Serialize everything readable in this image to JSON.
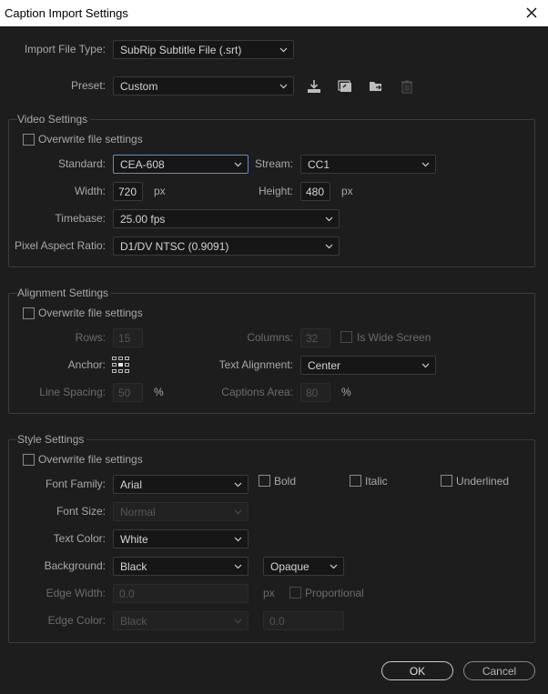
{
  "window": {
    "title": "Caption Import Settings"
  },
  "top": {
    "import_file_type_label": "Import File Type:",
    "import_file_type_value": "SubRip Subtitle File (.srt)",
    "preset_label": "Preset:",
    "preset_value": "Custom"
  },
  "video": {
    "legend": "Video Settings",
    "overwrite_label": "Overwrite file settings",
    "standard_label": "Standard:",
    "standard_value": "CEA-608",
    "stream_label": "Stream:",
    "stream_value": "CC1",
    "width_label": "Width:",
    "width_value": "720",
    "width_unit": "px",
    "height_label": "Height:",
    "height_value": "480",
    "height_unit": "px",
    "timebase_label": "Timebase:",
    "timebase_value": "25.00 fps",
    "par_label": "Pixel Aspect Ratio:",
    "par_value": "D1/DV NTSC (0.9091)"
  },
  "alignment": {
    "legend": "Alignment Settings",
    "overwrite_label": "Overwrite file settings",
    "rows_label": "Rows:",
    "rows_value": "15",
    "columns_label": "Columns:",
    "columns_value": "32",
    "wide_screen_label": "Is Wide Screen",
    "anchor_label": "Anchor:",
    "text_alignment_label": "Text Alignment:",
    "text_alignment_value": "Center",
    "line_spacing_label": "Line Spacing:",
    "line_spacing_value": "50",
    "line_spacing_unit": "%",
    "captions_area_label": "Captions Area:",
    "captions_area_value": "80",
    "captions_area_unit": "%"
  },
  "style": {
    "legend": "Style Settings",
    "overwrite_label": "Overwrite file settings",
    "font_family_label": "Font Family:",
    "font_family_value": "Arial",
    "bold_label": "Bold",
    "italic_label": "Italic",
    "underlined_label": "Underlined",
    "font_size_label": "Font Size:",
    "font_size_value": "Normal",
    "text_color_label": "Text Color:",
    "text_color_value": "White",
    "background_label": "Background:",
    "background_value": "Black",
    "opacity_value": "Opaque",
    "edge_width_label": "Edge Width:",
    "edge_width_value": "0.0",
    "edge_width_unit": "px",
    "proportional_label": "Proportional",
    "edge_color_label": "Edge Color:",
    "edge_color_value": "Black",
    "edge_opacity_value": "0.0"
  },
  "buttons": {
    "ok": "OK",
    "cancel": "Cancel"
  },
  "colors": {
    "background": "#1d1d1d",
    "focus_border": "#5a8fd6",
    "titlebar": "#ffffff"
  }
}
